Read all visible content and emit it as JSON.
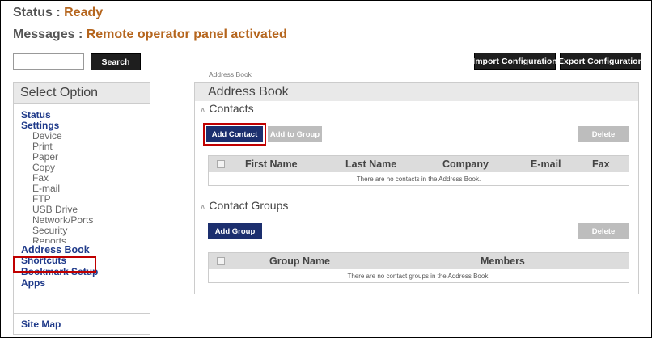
{
  "status": {
    "label": "Status :",
    "value": "Ready"
  },
  "messages": {
    "label": "Messages :",
    "value": "Remote operator panel activated"
  },
  "search": {
    "value": "",
    "button_label": "Search"
  },
  "toolbar": {
    "import_label": "Import Configuration",
    "export_label": "Export Configuration"
  },
  "breadcrumb": "Address Book",
  "sidebar": {
    "title": "Select Option",
    "items": [
      {
        "label": "Status",
        "level": "main"
      },
      {
        "label": "Settings",
        "level": "main"
      },
      {
        "label": "Device",
        "level": "sub"
      },
      {
        "label": "Print",
        "level": "sub"
      },
      {
        "label": "Paper",
        "level": "sub"
      },
      {
        "label": "Copy",
        "level": "sub"
      },
      {
        "label": "Fax",
        "level": "sub"
      },
      {
        "label": "E-mail",
        "level": "sub"
      },
      {
        "label": "FTP",
        "level": "sub"
      },
      {
        "label": "USB Drive",
        "level": "sub"
      },
      {
        "label": "Network/Ports",
        "level": "sub"
      },
      {
        "label": "Security",
        "level": "sub"
      },
      {
        "label": "Reports",
        "level": "sub"
      },
      {
        "label": "Address Book",
        "level": "main",
        "selected": true
      },
      {
        "label": "Shortcuts",
        "level": "main"
      },
      {
        "label": "Bookmark Setup",
        "level": "main"
      },
      {
        "label": "Apps",
        "level": "main"
      }
    ],
    "site_map": "Site Map"
  },
  "main": {
    "title": "Address Book",
    "contacts": {
      "title": "Contacts",
      "add_contact_label": "Add Contact",
      "add_to_group_label": "Add to Group",
      "delete_label": "Delete",
      "columns": [
        "First Name",
        "Last Name",
        "Company",
        "E-mail",
        "Fax"
      ],
      "empty_message": "There are no contacts in the Address Book."
    },
    "groups": {
      "title": "Contact Groups",
      "add_group_label": "Add Group",
      "delete_label": "Delete",
      "columns": [
        "Group Name",
        "Members"
      ],
      "empty_message": "There are no contact groups in the Address Book."
    }
  },
  "colors": {
    "status_value": "#b5651d",
    "nav_link": "#1f3a8a",
    "primary_button": "#1c2f6e",
    "disabled_button": "#bdbdbd",
    "highlight": "#c00000"
  }
}
